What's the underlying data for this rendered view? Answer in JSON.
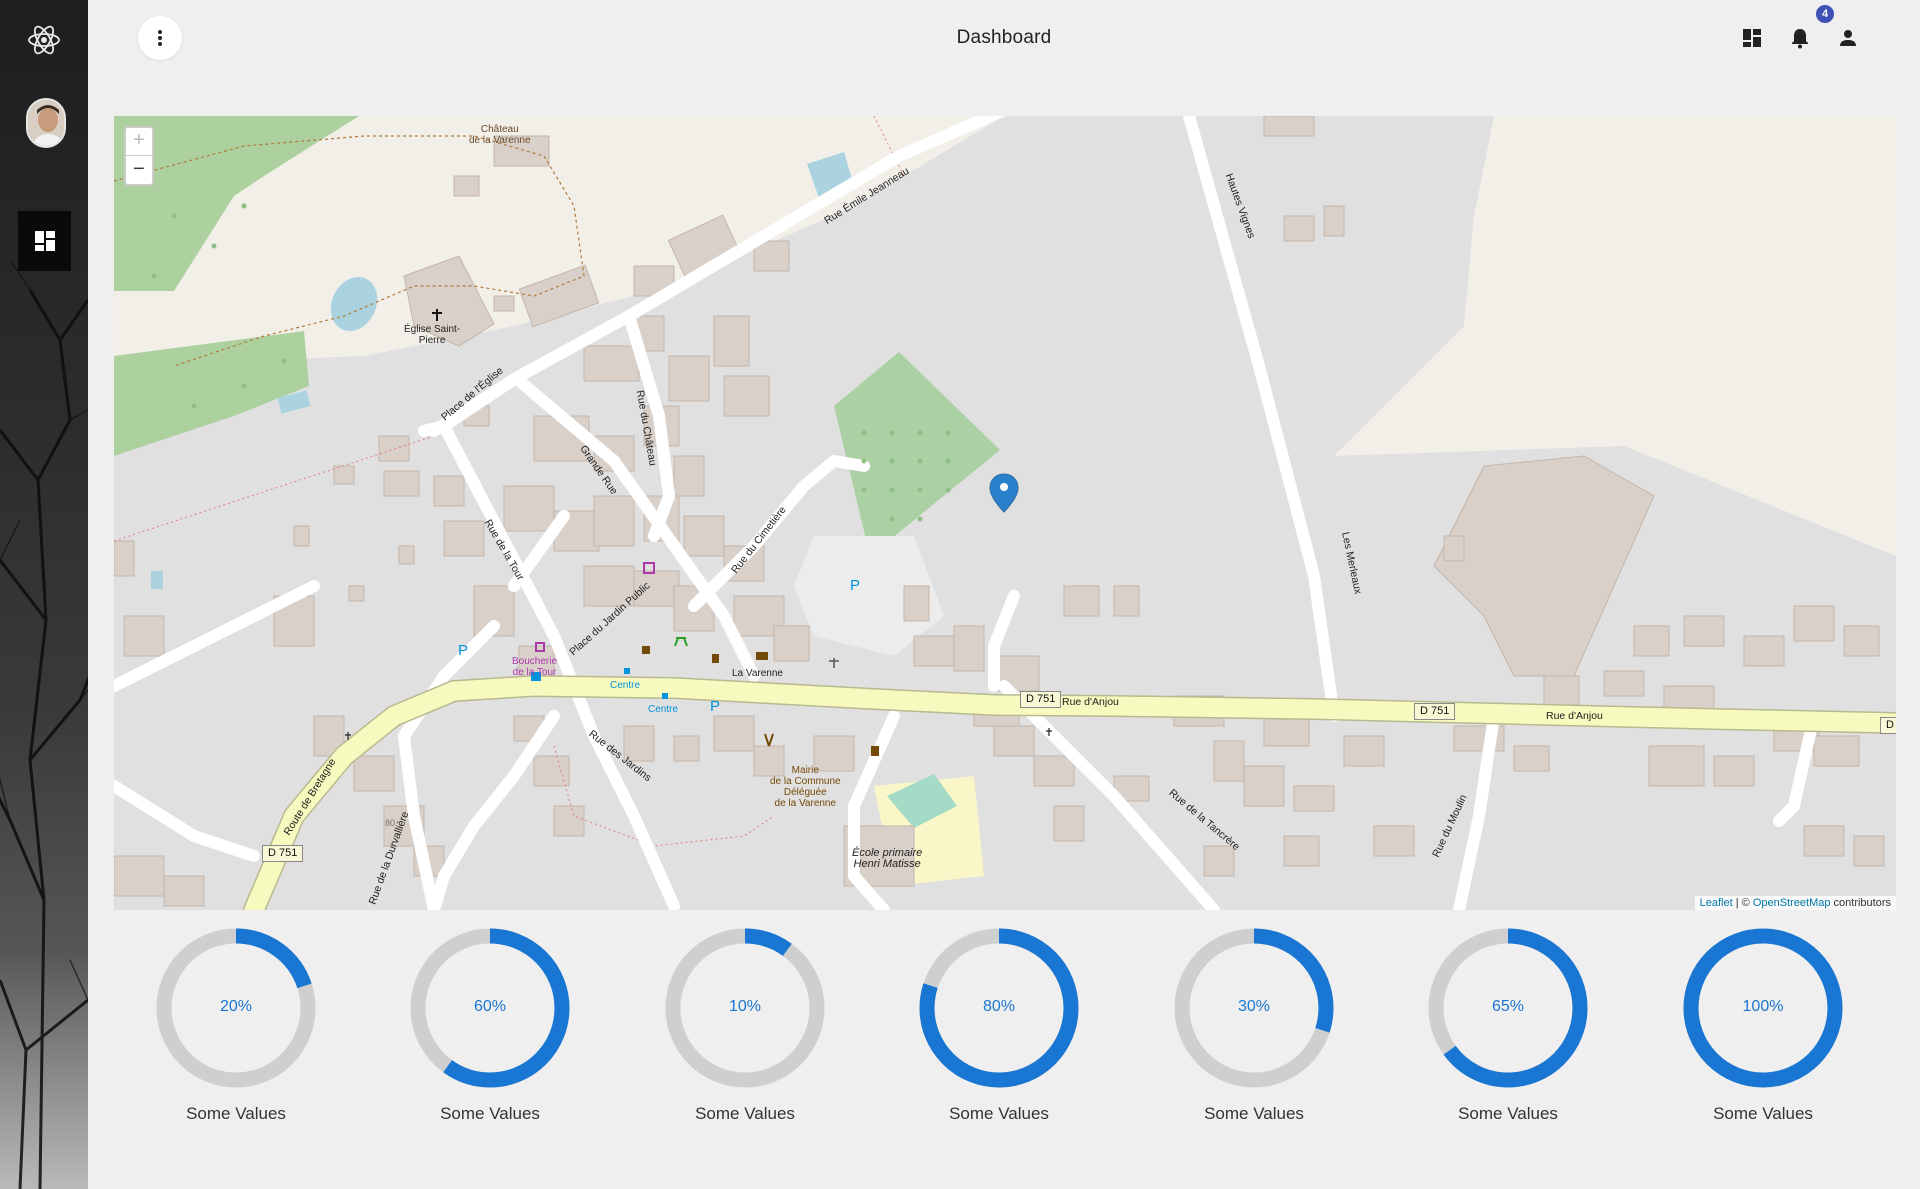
{
  "header": {
    "title": "Dashboard",
    "notification_count": "4",
    "icons": [
      "dashboard-icon",
      "bell-icon",
      "person-icon"
    ]
  },
  "sidebar": {
    "logo": "react-atom-icon",
    "avatar": "user-avatar",
    "active_item": "dashboard-icon"
  },
  "map": {
    "zoom_in": "+",
    "zoom_out": "−",
    "attribution": {
      "leaflet": "Leaflet",
      "separator": " | © ",
      "osm": "OpenStreetMap",
      "suffix": " contributors"
    },
    "streets": {
      "emile": "Rue Émile Jeanneau",
      "hautes": "Hautes Vignes",
      "eglise": "Place de l'Église",
      "chateau": "Rue du Château",
      "grande": "Grande Rue",
      "tour": "Rue de la Tour",
      "cimetiere": "Rue du Cimetière",
      "jardin_public": "Place du Jardin Public",
      "merleaux": "Les Merleaux",
      "anjou1": "Rue d'Anjou",
      "anjou2": "Rue d'Anjou",
      "bretagne": "Route de Bretagne",
      "durvalliere": "Rue de la Durvallière",
      "jardins": "Rue des Jardins",
      "tancrere": "Rue de la Tancrère",
      "moulin": "Rue du Moulin"
    },
    "shields": [
      "D 751",
      "D 751",
      "D 751",
      "D"
    ],
    "places": {
      "chateau_varenne": "Château\nde la Varenne",
      "eglise_st_pierre": "Église Saint-\nPierre",
      "boucherie": "Boucherie\nde la Tour",
      "centre1": "Centre",
      "centre2": "Centre",
      "la_varenne": "La Varenne",
      "mairie": "Mairie\nde la Commune\nDéléguée\nde la Varenne",
      "ecole": "École primaire\nHenri Matisse",
      "house_number": "80"
    },
    "parking": [
      "P",
      "P",
      "P"
    ]
  },
  "gauges": [
    {
      "label": "Some Values",
      "value": 20,
      "text": "20%"
    },
    {
      "label": "Some Values",
      "value": 60,
      "text": "60%"
    },
    {
      "label": "Some Values",
      "value": 10,
      "text": "10%"
    },
    {
      "label": "Some Values",
      "value": 80,
      "text": "80%"
    },
    {
      "label": "Some Values",
      "value": 30,
      "text": "30%"
    },
    {
      "label": "Some Values",
      "value": 65,
      "text": "65%"
    },
    {
      "label": "Some Values",
      "value": 100,
      "text": "100%"
    }
  ],
  "colors": {
    "gauge_fill": "#1976d2",
    "gauge_track": "#cfcfcf",
    "badge": "#3f51b5",
    "main_road": "#f7fabf",
    "building": "#d9d0c9",
    "forest": "#add19e",
    "marker": "#2a81cb"
  }
}
